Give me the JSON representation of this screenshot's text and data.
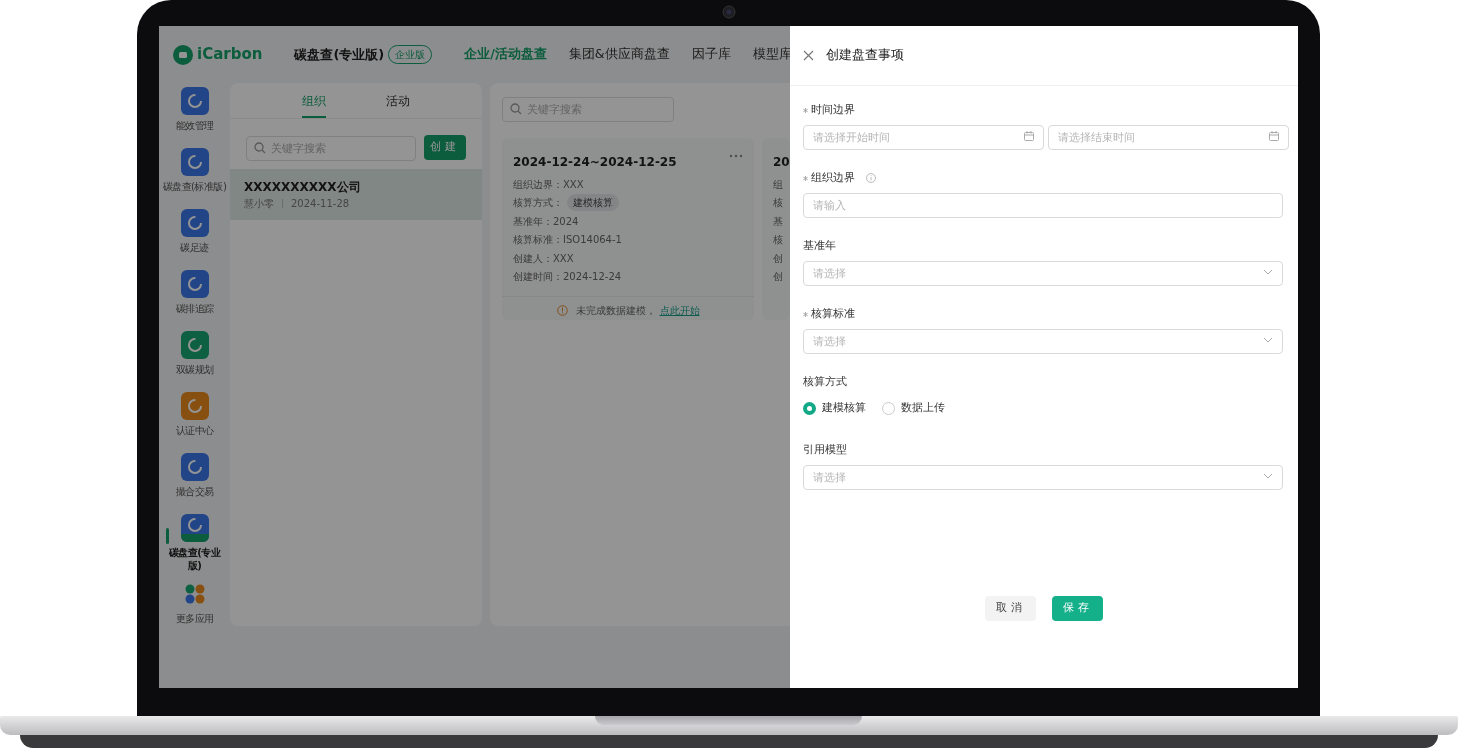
{
  "app": {
    "logo": "iCarbon",
    "product": "碳盘查(专业版)",
    "edition_badge": "企业版",
    "nav": [
      {
        "label": "企业/活动盘查",
        "selected": true
      },
      {
        "label": "集团&供应商盘查",
        "selected": false
      },
      {
        "label": "因子库",
        "selected": false
      },
      {
        "label": "模型库",
        "selected": false
      }
    ],
    "sidebar": {
      "items": [
        {
          "label": "能效管理",
          "kind": "blue",
          "selected": false
        },
        {
          "label": "碳盘查(标准版)",
          "kind": "blue",
          "selected": false
        },
        {
          "label": "碳足迹",
          "kind": "blue",
          "selected": false
        },
        {
          "label": "碳排追踪",
          "kind": "blue",
          "selected": false
        },
        {
          "label": "双碳规划",
          "kind": "green",
          "selected": false
        },
        {
          "label": "认证中心",
          "kind": "orange",
          "selected": false
        },
        {
          "label": "撮合交易",
          "kind": "blue",
          "selected": false
        },
        {
          "label": "碳盘查(专业版)",
          "kind": "banded",
          "selected": true
        },
        {
          "label": "更多应用",
          "kind": "more",
          "selected": false
        }
      ]
    },
    "left_panel": {
      "tabs": [
        {
          "label": "组织",
          "selected": true
        },
        {
          "label": "活动",
          "selected": false
        }
      ],
      "search": {
        "placeholder": "关键字搜索"
      },
      "create_button": "创建",
      "list": [
        {
          "title": "XXXXXXXXXX公司",
          "owner": "慧小零",
          "date": "2024-11-28",
          "selected": true
        }
      ]
    },
    "right_panel": {
      "search": {
        "placeholder": "关键字搜索"
      },
      "cards": [
        {
          "title": "2024-12-24~2024-12-25",
          "lines": [
            {
              "text": "组织边界：XXX"
            },
            {
              "text": "核算方式：",
              "tag": "建模核算"
            },
            {
              "text": "基准年：2024"
            },
            {
              "text": "核算标准：ISO14064-1"
            },
            {
              "text": "创建人：XXX"
            },
            {
              "text": "创建时间：2024-12-24"
            }
          ],
          "notice": "未完成数据建模，",
          "notice_link": "点此开始"
        },
        {
          "title": "20",
          "lines": [
            {
              "text": "组"
            },
            {
              "text": "核"
            },
            {
              "text": "基"
            },
            {
              "text": "核"
            },
            {
              "text": "创"
            },
            {
              "text": "创"
            }
          ]
        }
      ]
    }
  },
  "drawer": {
    "title": "创建盘查事项",
    "fields": [
      {
        "kind": "date-range",
        "label": "时间边界",
        "required": true,
        "info": false,
        "placeholders": [
          "请选择开始时间",
          "请选择结束时间"
        ]
      },
      {
        "kind": "text",
        "label": "组织边界",
        "required": true,
        "info": true,
        "placeholder": "请输入"
      },
      {
        "kind": "select",
        "label": "基准年",
        "required": false,
        "info": false,
        "placeholder": "请选择"
      },
      {
        "kind": "select",
        "label": "核算标准",
        "required": true,
        "info": false,
        "placeholder": "请选择"
      },
      {
        "kind": "radio",
        "label": "核算方式",
        "required": false,
        "info": false,
        "options": [
          {
            "label": "建模核算",
            "selected": true
          },
          {
            "label": "数据上传",
            "selected": false
          }
        ]
      },
      {
        "kind": "select",
        "label": "引用模型",
        "required": false,
        "info": false,
        "placeholder": "请选择"
      }
    ],
    "buttons": [
      {
        "label": "取消",
        "kind": "default"
      },
      {
        "label": "保存",
        "kind": "primary"
      }
    ]
  }
}
